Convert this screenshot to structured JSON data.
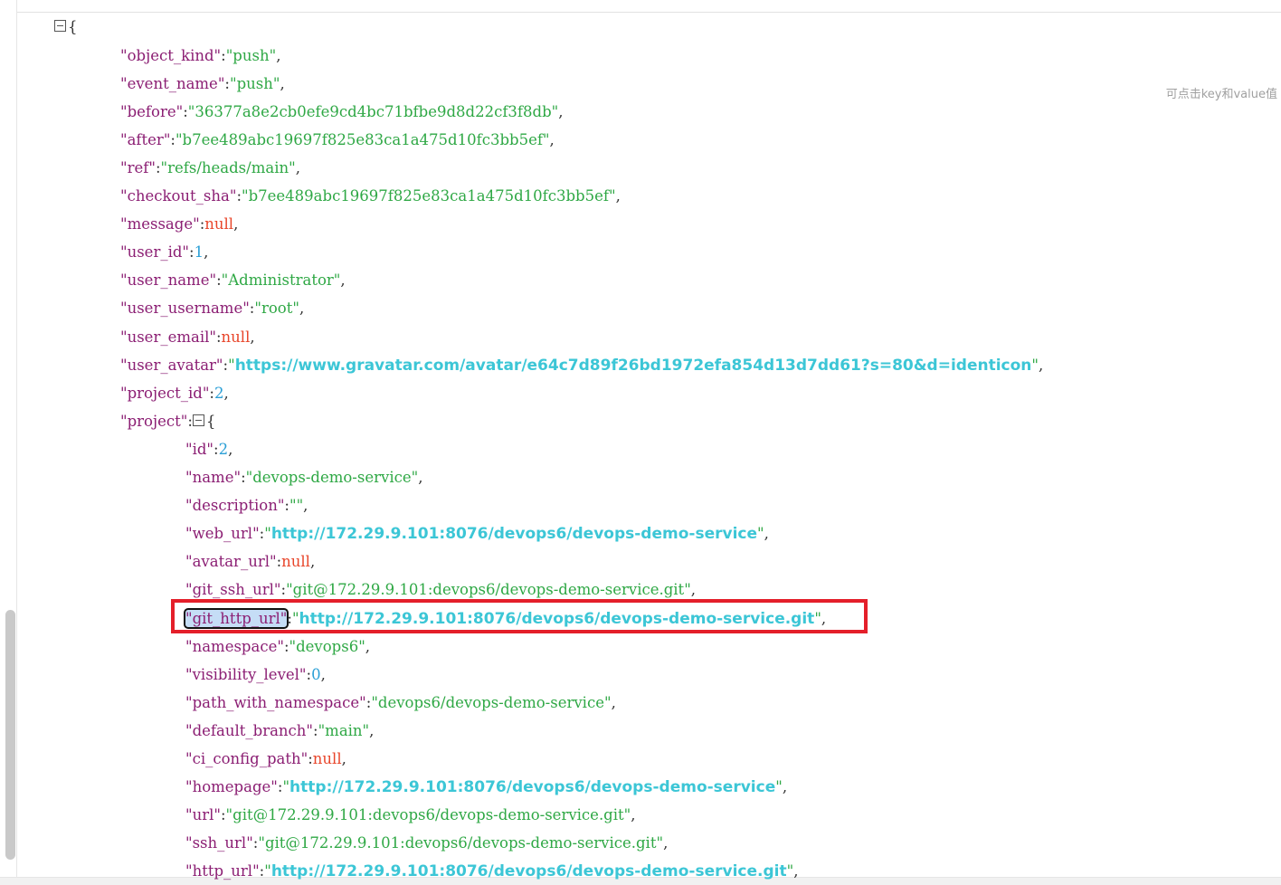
{
  "hint_text": "可点击key和value值",
  "json": {
    "open_brace": "{",
    "fields": [
      {
        "key": "object_kind",
        "value": "push",
        "type": "string"
      },
      {
        "key": "event_name",
        "value": "push",
        "type": "string"
      },
      {
        "key": "before",
        "value": "36377a8e2cb0efe9cd4bc71bfbe9d8d22cf3f8db",
        "type": "string"
      },
      {
        "key": "after",
        "value": "b7ee489abc19697f825e83ca1a475d10fc3bb5ef",
        "type": "string"
      },
      {
        "key": "ref",
        "value": "refs/heads/main",
        "type": "string"
      },
      {
        "key": "checkout_sha",
        "value": "b7ee489abc19697f825e83ca1a475d10fc3bb5ef",
        "type": "string"
      },
      {
        "key": "message",
        "value": "null",
        "type": "null"
      },
      {
        "key": "user_id",
        "value": "1",
        "type": "number"
      },
      {
        "key": "user_name",
        "value": "Administrator",
        "type": "string"
      },
      {
        "key": "user_username",
        "value": "root",
        "type": "string"
      },
      {
        "key": "user_email",
        "value": "null",
        "type": "null"
      },
      {
        "key": "user_avatar",
        "value": "https://www.gravatar.com/avatar/e64c7d89f26bd1972efa854d13d7dd61?s=80&d=identicon",
        "type": "url"
      },
      {
        "key": "project_id",
        "value": "2",
        "type": "number"
      },
      {
        "key": "project",
        "value": "{",
        "type": "object"
      }
    ],
    "project_fields": [
      {
        "key": "id",
        "value": "2",
        "type": "number"
      },
      {
        "key": "name",
        "value": "devops-demo-service",
        "type": "string"
      },
      {
        "key": "description",
        "value": "",
        "type": "string"
      },
      {
        "key": "web_url",
        "value": "http://172.29.9.101:8076/devops6/devops-demo-service",
        "type": "url"
      },
      {
        "key": "avatar_url",
        "value": "null",
        "type": "null"
      },
      {
        "key": "git_ssh_url",
        "value": "git@172.29.9.101:devops6/devops-demo-service.git",
        "type": "string"
      },
      {
        "key": "git_http_url",
        "value": "http://172.29.9.101:8076/devops6/devops-demo-service.git",
        "type": "url",
        "selected": true
      },
      {
        "key": "namespace",
        "value": "devops6",
        "type": "string"
      },
      {
        "key": "visibility_level",
        "value": "0",
        "type": "number"
      },
      {
        "key": "path_with_namespace",
        "value": "devops6/devops-demo-service",
        "type": "string"
      },
      {
        "key": "default_branch",
        "value": "main",
        "type": "string"
      },
      {
        "key": "ci_config_path",
        "value": "null",
        "type": "null"
      },
      {
        "key": "homepage",
        "value": "http://172.29.9.101:8076/devops6/devops-demo-service",
        "type": "url"
      },
      {
        "key": "url",
        "value": "git@172.29.9.101:devops6/devops-demo-service.git",
        "type": "string"
      },
      {
        "key": "ssh_url",
        "value": "git@172.29.9.101:devops6/devops-demo-service.git",
        "type": "string"
      },
      {
        "key": "http_url",
        "value": "http://172.29.9.101:8076/devops6/devops-demo-service.git",
        "type": "url"
      }
    ]
  },
  "colors": {
    "key": "#8b1e73",
    "string": "#2fa845",
    "null": "#e8452a",
    "number": "#2a9fd6",
    "url": "#3cc6d6",
    "highlight_border": "#e41f2a"
  }
}
